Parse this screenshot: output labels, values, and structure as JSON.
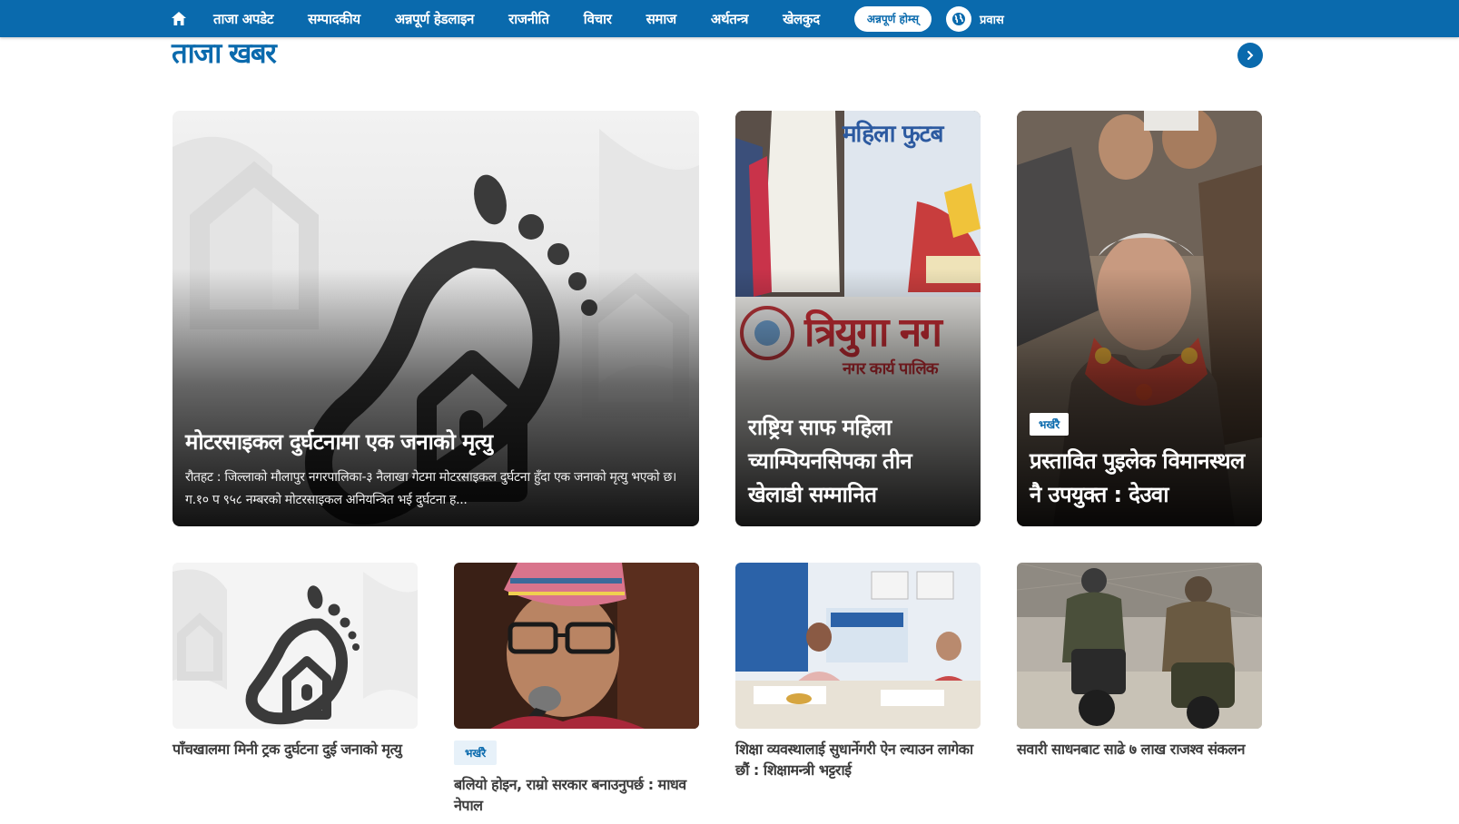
{
  "nav": {
    "items": [
      "ताजा अपडेट",
      "सम्पादकीय",
      "अन्नपूर्ण हेडलाइन",
      "राजनीति",
      "विचार",
      "समाज",
      "अर्थतन्त्र",
      "खेलकुद"
    ],
    "pill_label": "अन्नपूर्ण होम्स्",
    "pravas_label": "प्रवास"
  },
  "section": {
    "title": "ताजा खबर"
  },
  "featured": [
    {
      "title": "मोटरसाइकल दुर्घटनामा एक जनाको मृत्यु",
      "summary": "रौतहट : जिल्लाको मौलापुर नगरपालिका-३ नैलाखा गेटमा मोटरसाइकल दुर्घटना हुँदा एक जनाको मृत्यु भएको छ। ग.१० प ९५८ नम्बरको मोटरसाइकल अनियन्त्रित भई दुर्घटना ह..."
    },
    {
      "title": "राष्ट्रिय साफ महिला च्याम्पियनसिपका तीन खेलाडी सम्मानित",
      "banner_text_1": "महिला फुटब",
      "banner_text_2": "त्रियुगा नग",
      "banner_text_3": "नगर कार्य पालिक"
    },
    {
      "badge": "भर्खरै",
      "title": "प्रस्तावित पुइलेक विमानस्थल नै उपयुक्त : देउवा"
    }
  ],
  "stories": [
    {
      "title": "पाँचखालमा मिनी ट्रक दुर्घटना दुई जनाको मृत्यु"
    },
    {
      "badge": "भर्खरै",
      "title": "बलियो होइन, राम्रो सरकार बनाउनुपर्छ : माधव नेपाल"
    },
    {
      "title": "शिक्षा व्यवस्थालाई सुधार्नेगरी ऐन ल्याउन लागेका छौं : शिक्षामन्त्री भट्टराई"
    },
    {
      "title": "सवारी साधनबाट साढे ७ लाख राजश्व संकलन"
    }
  ],
  "colors": {
    "brand": "#0a6aad",
    "badge_bg": "#e7f1f9"
  }
}
